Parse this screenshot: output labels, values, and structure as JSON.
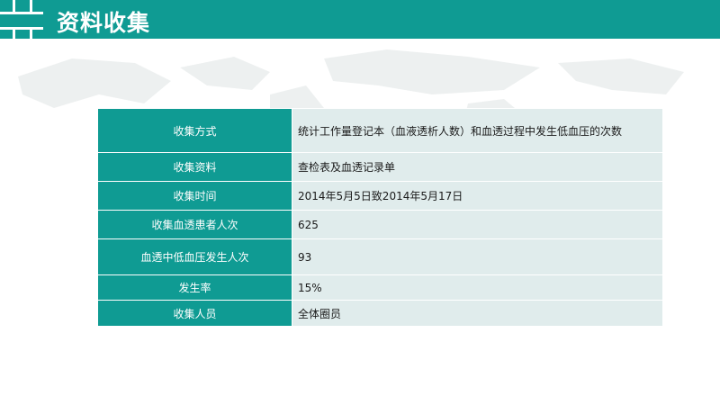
{
  "header": {
    "title": "资料收集"
  },
  "table": {
    "rows": [
      {
        "label": "收集方式",
        "value": "统计工作量登记本（血液透析人数）和血透过程中发生低血压的次数"
      },
      {
        "label": "收集资料",
        "value": "查检表及血透记录单"
      },
      {
        "label": "收集时间",
        "value": "2014年5月5日致2014年5月17日"
      },
      {
        "label": "收集血透患者人次",
        "value": "625"
      },
      {
        "label": "血透中低血压发生人次",
        "value": "93"
      },
      {
        "label": "发生率",
        "value": "15%"
      },
      {
        "label": "收集人员",
        "value": "全体圈员"
      }
    ]
  },
  "colors": {
    "accent": "#0f9b93",
    "cell_bg": "#e0ecec"
  }
}
